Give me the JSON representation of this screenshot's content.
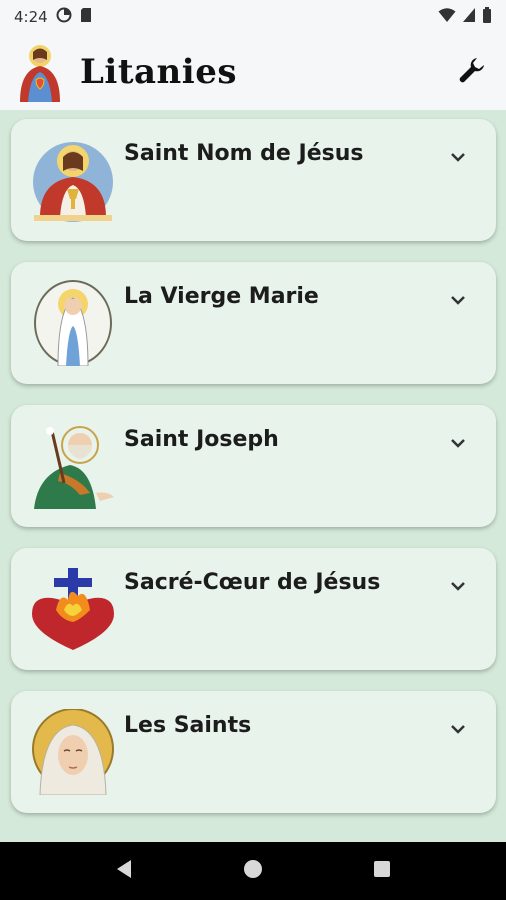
{
  "status_bar": {
    "time": "4:24",
    "icons": [
      "data-saver-icon",
      "sd-card-icon",
      "wifi-icon",
      "signal-icon",
      "battery-icon"
    ]
  },
  "app_bar": {
    "title": "Litanies",
    "logo": "sacred-heart-logo",
    "settings_icon": "wrench-icon"
  },
  "litanies": [
    {
      "title": "Saint Nom de Jésus",
      "icon": "jesus-eucharist-icon"
    },
    {
      "title": "La Vierge Marie",
      "icon": "virgin-mary-icon"
    },
    {
      "title": "Saint Joseph",
      "icon": "saint-joseph-icon"
    },
    {
      "title": "Sacré-Cœur de Jésus",
      "icon": "sacred-heart-icon"
    },
    {
      "title": "Les Saints",
      "icon": "saints-icon"
    }
  ],
  "nav_bar": {
    "buttons": [
      "back-icon",
      "home-icon",
      "recents-icon"
    ]
  },
  "colors": {
    "background": "#d4e9d9",
    "card": "#e8f3eb",
    "app_bar": "#f6f7f8"
  }
}
